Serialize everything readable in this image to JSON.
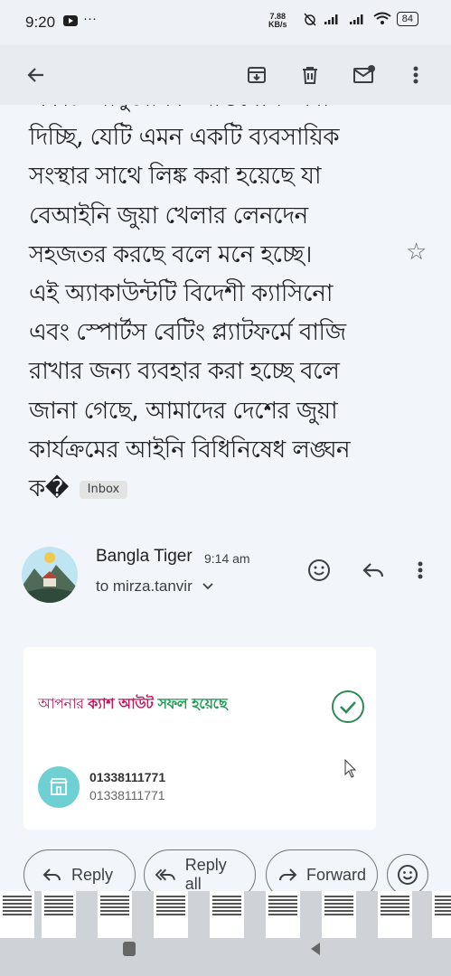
{
  "status": {
    "time": "9:20",
    "dots": "···",
    "net_speed_value": "7.88",
    "net_speed_unit": "KB/s",
    "battery": "84"
  },
  "appbar": {
    "back_icon": "arrow-left-icon",
    "archive_icon": "archive-icon",
    "delete_icon": "trash-icon",
    "mark_unread_icon": "mail-unread-icon",
    "more_icon": "more-vertical-icon"
  },
  "email": {
    "body_lines": [
      "একটি আনুষ্ঠানিক অভিযোগ জমা",
      "দিচ্ছি, যেটি এমন একটি ব্যবসায়িক",
      "সংস্থার সাথে লিঙ্ক করা হয়েছে যা",
      "বেআইনি জুয়া খেলার লেনদেন",
      "সহজতর করছে বলে মনে হচ্ছে।",
      "এই অ্যাকাউন্টটি বিদেশী ক্যাসিনো",
      "এবং স্পোর্টস বেটিং প্ল্যাটফর্মে বাজি",
      "রাখার জন্য ব্যবহার করা হচ্ছে বলে",
      "জানা গেছে, আমাদের দেশের জুয়া",
      "কার্যক্রমের আইনি বিধিনিষেধ লঙ্ঘন"
    ],
    "last_line": "ক�",
    "label_chip": "Inbox",
    "sender": "Bangla Tiger",
    "time": "9:14 am",
    "to": "to mirza.tanvir",
    "card": {
      "title_part1": "আপনার ",
      "title_part2": "ক্যাশ আউট ",
      "title_part3": " সফল হয়েছে",
      "phone_primary": "01338111771",
      "phone_secondary": "01338111771"
    }
  },
  "actions": {
    "reply": "Reply",
    "reply_all": "Reply all",
    "forward": "Forward"
  },
  "colors": {
    "accent_pink": "#c2185b",
    "accent_green": "#1e9c55",
    "store_teal": "#6ed0d3"
  }
}
